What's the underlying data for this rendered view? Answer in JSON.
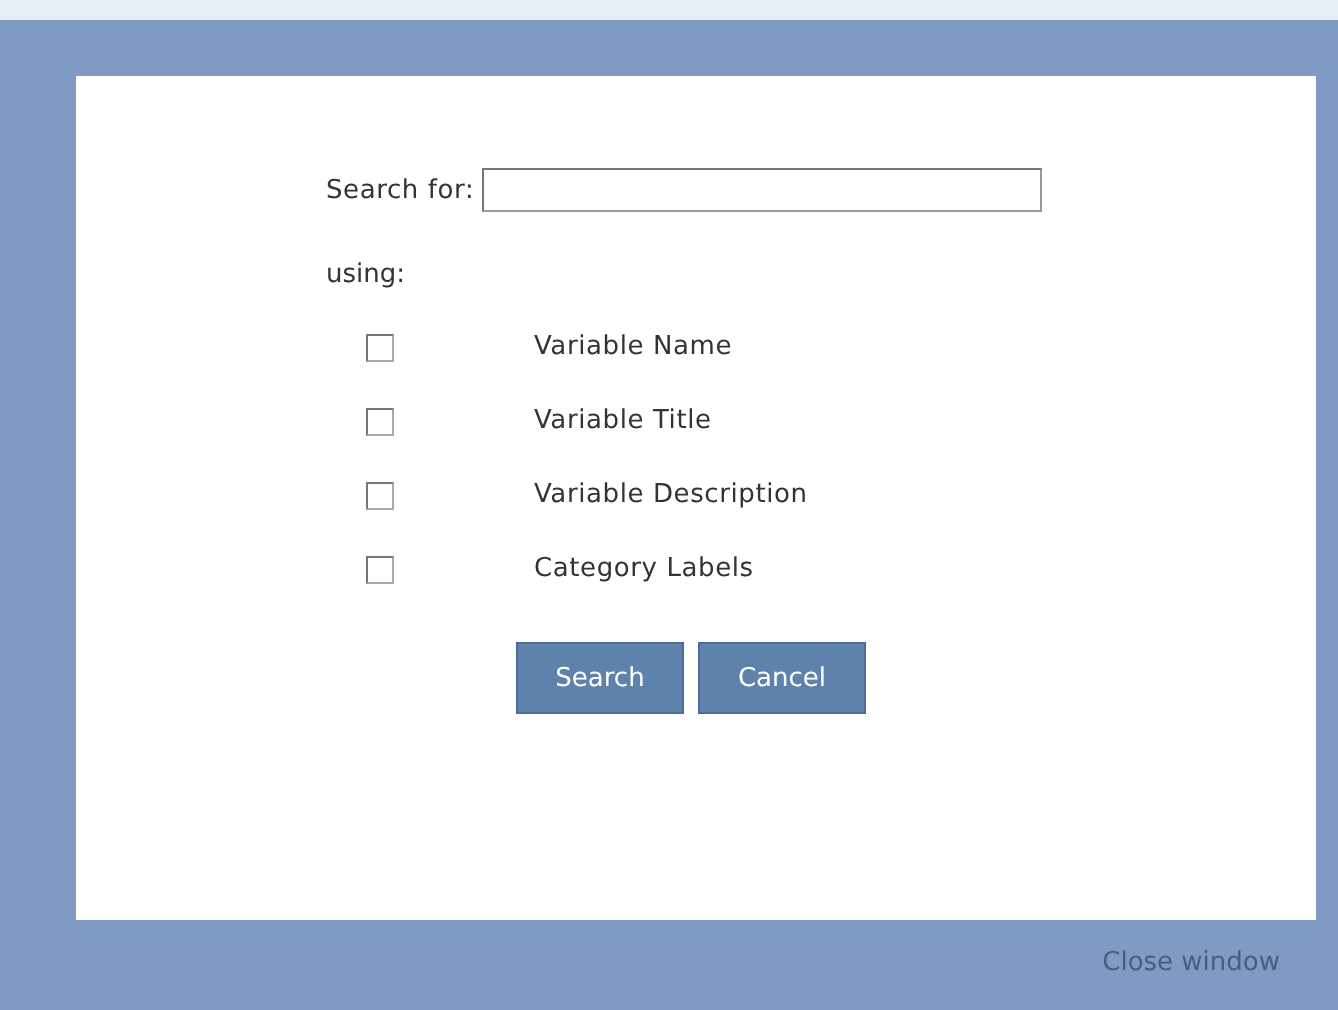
{
  "search": {
    "label": "Search for:"
  },
  "using_label": "using:",
  "options": [
    {
      "label": "Variable Name",
      "checked": false
    },
    {
      "label": "Variable Title",
      "checked": false
    },
    {
      "label": "Variable Description",
      "checked": false
    },
    {
      "label": "Category Labels",
      "checked": false
    }
  ],
  "buttons": [
    "Search",
    "Cancel"
  ],
  "close_link": "Close window"
}
